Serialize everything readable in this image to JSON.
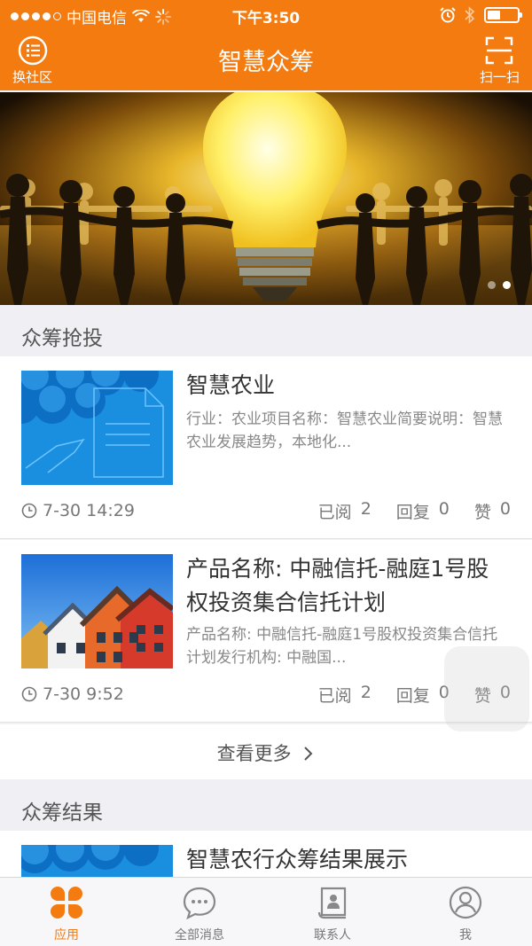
{
  "status_bar": {
    "carrier": "中国电信",
    "time": "下午3:50"
  },
  "nav": {
    "title": "智慧众筹",
    "left_label": "换社区",
    "right_label": "扫一扫"
  },
  "banner": {
    "slide_count": 2,
    "active_slide": 2
  },
  "sections": {
    "invest": {
      "title": "众筹抢投"
    },
    "results": {
      "title": "众筹结果"
    }
  },
  "items": [
    {
      "title": "智慧农业",
      "desc": "行业：农业项目名称：智慧农业简要说明：智慧农业发展趋势，本地化...",
      "date": "7-30 14:29",
      "read_label": "已阅",
      "read_count": "2",
      "reply_label": "回复",
      "reply_count": "0",
      "like_label": "赞",
      "like_count": "0"
    },
    {
      "title": "产品名称: 中融信托-融庭1号股权投资集合信托计划",
      "desc": "产品名称: 中融信托-融庭1号股权投资集合信托计划发行机构: 中融国...",
      "date": "7-30 9:52",
      "read_label": "已阅",
      "read_count": "2",
      "reply_label": "回复",
      "reply_count": "0",
      "like_label": "赞",
      "like_count": "0"
    }
  ],
  "more_label": "查看更多",
  "result_item": {
    "title": "智慧农行众筹结果展示"
  },
  "tabs": [
    {
      "label": "应用",
      "icon": "apps-icon",
      "active": true
    },
    {
      "label": "全部消息",
      "icon": "chat-icon",
      "active": false
    },
    {
      "label": "联系人",
      "icon": "contacts-icon",
      "active": false
    },
    {
      "label": "我",
      "icon": "profile-icon",
      "active": false
    }
  ],
  "colors": {
    "brand": "#f47b0f",
    "section_bg": "#efeff4"
  }
}
